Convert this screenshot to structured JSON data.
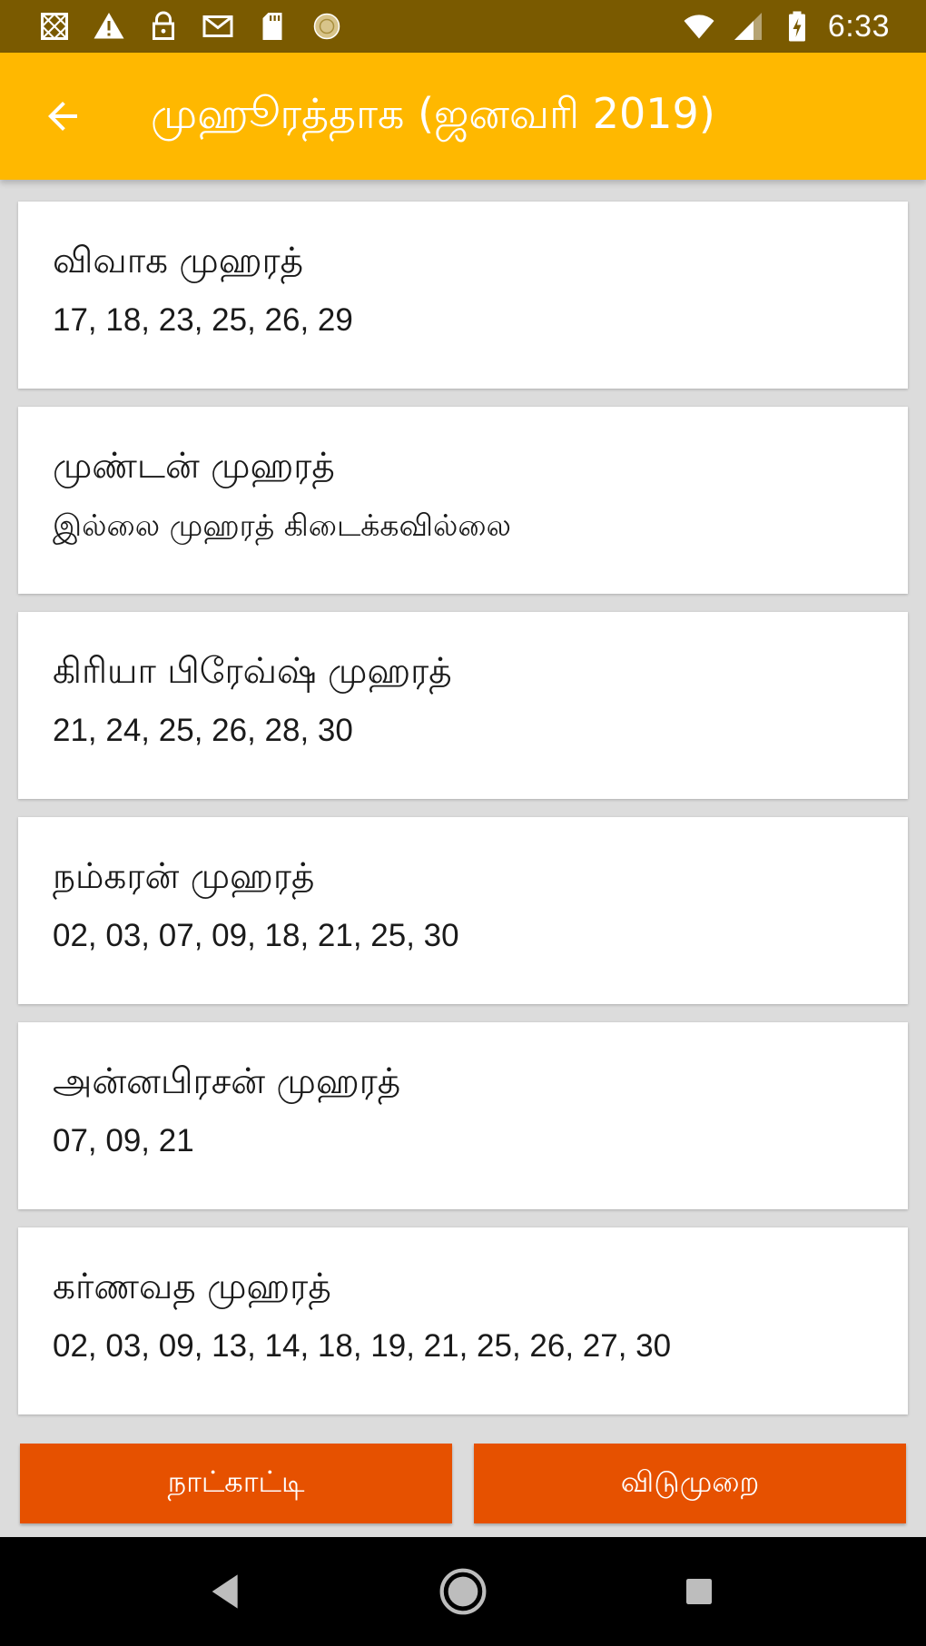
{
  "status_bar": {
    "time": "6:33",
    "left_icons": [
      "gallery-icon",
      "warning-icon",
      "lock-icon",
      "gmail-icon",
      "sd-card-icon",
      "sync-icon"
    ],
    "right_icons": [
      "wifi-icon",
      "signal-icon",
      "battery-charging-icon"
    ]
  },
  "app_bar": {
    "title": "முஹூரத்தாக (ஜனவரி 2019)",
    "color": "#ffb800"
  },
  "cards": [
    {
      "title": "விவாக முஹரத்",
      "dates": "17, 18, 23, 25, 26, 29"
    },
    {
      "title": "முண்டன் முஹரத்",
      "dates": "இல்லை முஹரத் கிடைக்கவில்லை"
    },
    {
      "title": "கிரியா பிரேவ்ஷ் முஹரத்",
      "dates": "21, 24, 25, 26, 28, 30"
    },
    {
      "title": "நம்கரன் முஹரத்",
      "dates": "02, 03, 07, 09, 18, 21, 25, 30"
    },
    {
      "title": "அன்னபிரசன் முஹரத்",
      "dates": "07, 09, 21"
    },
    {
      "title": "கர்ணவத முஹரத்",
      "dates": "02, 03, 09, 13, 14, 18, 19, 21, 25, 26, 27, 30"
    }
  ],
  "buttons": {
    "calendar_label": "நாட்காட்டி",
    "holidays_label": "விடுமுறை",
    "color": "#e65100"
  },
  "nav_bar": {
    "icons": [
      "back-triangle-icon",
      "home-circle-icon",
      "recents-square-icon"
    ]
  }
}
